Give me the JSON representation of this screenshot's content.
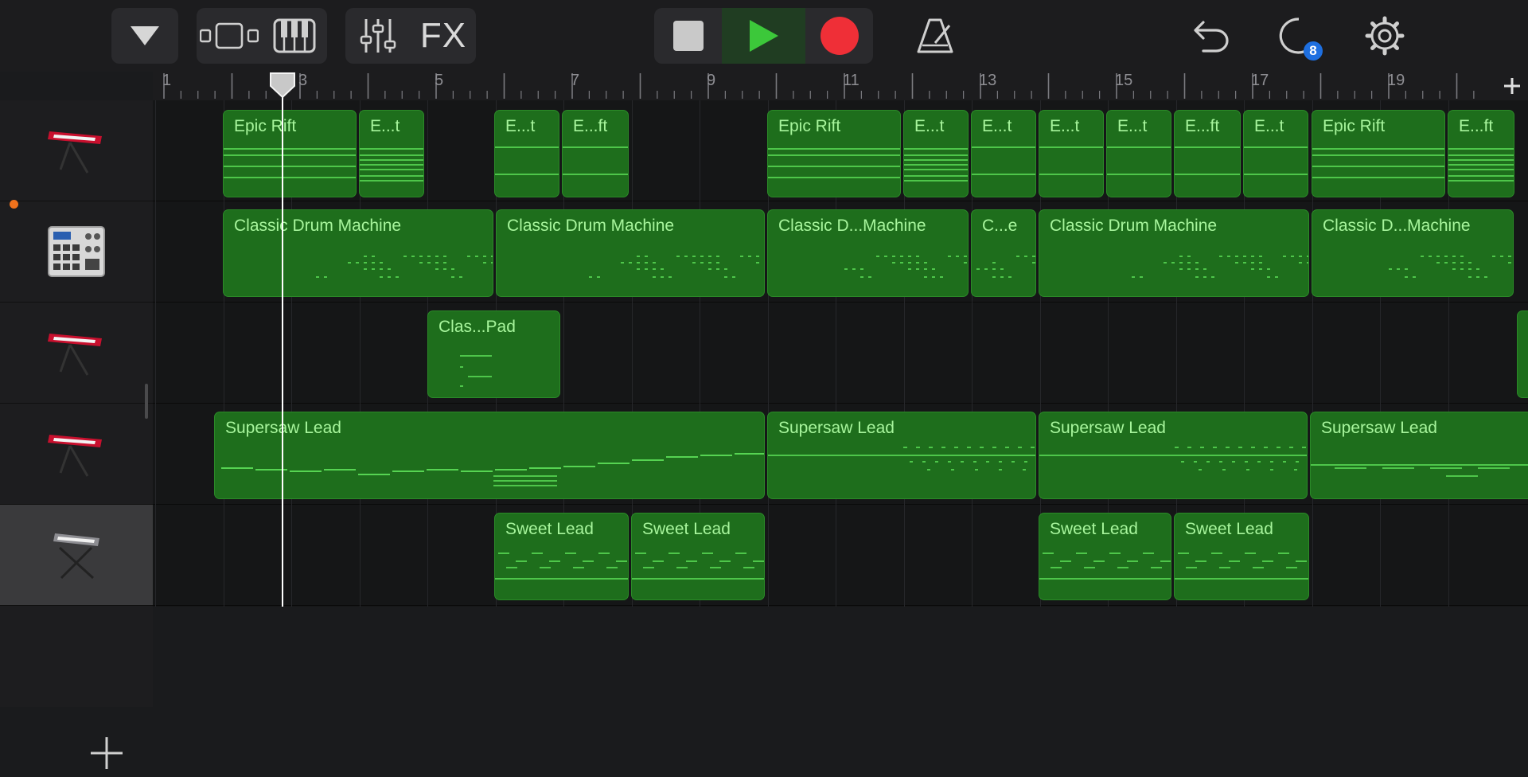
{
  "toolbar": {
    "dropdown_icon": "triangle-down-icon",
    "tracks_view_icon": "tracks-view-icon",
    "instrument_view_icon": "piano-keyboard-icon",
    "mixer_icon": "mixer-sliders-icon",
    "fx_label": "FX",
    "stop_icon": "stop-icon",
    "play_icon": "play-icon",
    "record_icon": "record-icon",
    "metronome_icon": "metronome-icon",
    "undo_icon": "undo-icon",
    "loops_icon": "loop-browser-icon",
    "loops_badge": "8",
    "settings_icon": "gear-icon",
    "colors": {
      "play": "#3cc83a",
      "record": "#ef2f37",
      "badge": "#1e6fe0"
    }
  },
  "ruler": {
    "bars": [
      "1",
      "3",
      "5",
      "7",
      "9",
      "11",
      "13",
      "15",
      "17",
      "19"
    ],
    "add_icon": "plus-icon"
  },
  "tracks": [
    {
      "name": "Keyboard",
      "icon": "red-synth-keyboard-icon",
      "selected": false,
      "regions": [
        "Epic Rift",
        "E...t",
        "E...t",
        "E...ft",
        "Epic Rift",
        "E...t",
        "E...t",
        "E...t",
        "E...t",
        "E...ft",
        "E...t",
        "Epic Rift",
        "E...ft"
      ]
    },
    {
      "name": "Drum Machine",
      "icon": "drum-machine-icon",
      "selected": false,
      "recording": true,
      "regions": [
        "Classic Drum Machine",
        "Classic Drum Machine",
        "Classic D...Machine",
        "C...e",
        "Classic Drum Machine",
        "Classic D...Machine"
      ]
    },
    {
      "name": "Keyboard",
      "icon": "red-synth-keyboard-icon",
      "selected": false,
      "regions": [
        "Clas...Pad"
      ]
    },
    {
      "name": "Keyboard",
      "icon": "red-synth-keyboard-icon",
      "selected": false,
      "regions": [
        "Supersaw Lead",
        "Supersaw Lead",
        "Supersaw Lead",
        "Supersaw Lead"
      ]
    },
    {
      "name": "Keyboard",
      "icon": "silver-keyboard-stand-icon",
      "selected": true,
      "regions": [
        "Sweet Lead",
        "Sweet Lead",
        "Sweet Lead",
        "Sweet Lead"
      ]
    }
  ],
  "add_track_icon": "plus-icon",
  "colors": {
    "region_fill": "#1e6e1c",
    "region_text": "#a7f59c",
    "note_line": "#5fe35a",
    "record_dot": "#f0721c"
  }
}
